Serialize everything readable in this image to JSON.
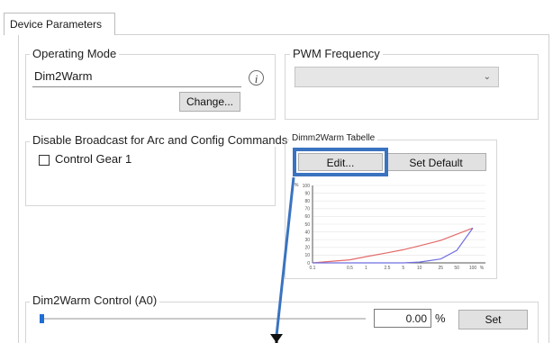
{
  "tab": {
    "label": "Device Parameters"
  },
  "operating_mode": {
    "legend": "Operating Mode",
    "value": "Dim2Warm",
    "info_glyph": "i",
    "change_label": "Change..."
  },
  "pwm": {
    "legend": "PWM Frequency",
    "value": ""
  },
  "broadcast": {
    "legend": "Disable Broadcast for Arc and Config Commands",
    "checkbox_label": "Control Gear 1",
    "checked": false
  },
  "table": {
    "legend": "Dimm2Warm Tabelle",
    "edit_label": "Edit...",
    "default_label": "Set Default"
  },
  "control": {
    "legend": "Dim2Warm Control (A0)",
    "value": "0.00",
    "unit": "%",
    "set_label": "Set",
    "slider_fraction": 0.0
  },
  "colors": {
    "accent": "#3a73c0",
    "curve_red": "#e36a6a",
    "curve_blue": "#6f6fe0",
    "thumb": "#1f6ed4"
  },
  "chart_data": {
    "type": "line",
    "ylabel": "%",
    "yticks": [
      "100",
      "90",
      "80",
      "70",
      "60",
      "50",
      "40",
      "30",
      "20",
      "10",
      "0"
    ],
    "xticks": [
      "0.1",
      "0.5",
      "1",
      "2.5",
      "5",
      "10",
      "25",
      "50",
      "100",
      "%"
    ],
    "xscale": "log",
    "ylim": [
      0,
      100
    ],
    "grid": true,
    "series": [
      {
        "color": "#e36a6a",
        "x": [
          0.1,
          0.5,
          1,
          2.5,
          5,
          10,
          25,
          50,
          100
        ],
        "values": [
          0,
          4,
          8,
          13,
          17,
          22,
          29,
          37,
          45
        ]
      },
      {
        "color": "#6f6fe0",
        "x": [
          0.1,
          0.5,
          1,
          2.5,
          5,
          10,
          25,
          50,
          100
        ],
        "values": [
          0,
          0,
          0,
          0,
          0,
          1,
          5,
          16,
          45
        ]
      }
    ]
  }
}
